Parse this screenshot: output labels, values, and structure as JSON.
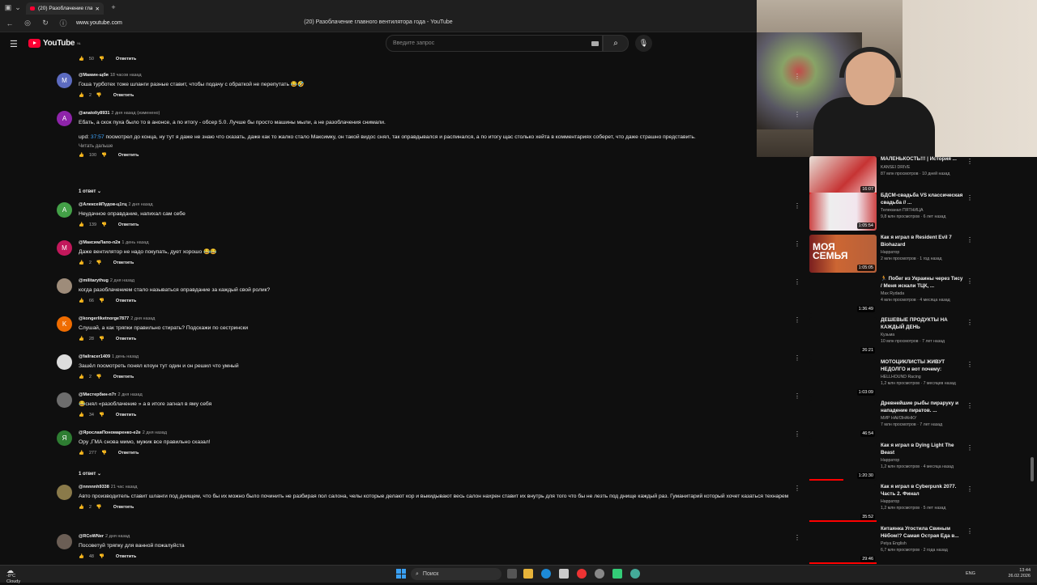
{
  "browser": {
    "tab_title": "(20) Разоблачение гла",
    "url": "www.youtube.com",
    "page_title": "(20) Разоблачение главного вентилятора года - YouTube"
  },
  "youtube": {
    "logo_text": "YouTube",
    "region": "NL",
    "search_placeholder": "Введите запрос"
  },
  "comments": {
    "top_actions": {
      "likes": "50",
      "reply": "Ответить"
    },
    "items": [
      {
        "author": "@Мамин-щбя",
        "time": "18 часов назад",
        "text": "Гоша турботех тоже шланги разные ставит, чтобы подачу с обраткой не перепутать 😂🤣",
        "likes": "2",
        "reply": "Ответить",
        "avatar": "M",
        "color": "#5c6bc0"
      },
      {
        "author": "@anatoliy8931",
        "time": "2 дня назад (изменено)",
        "text": "Ебать, а скок пуха было то в анонсе, а по итогу - обсер 5.0. Лучше бы просто машины мыли, а не разоблачения снимали.",
        "ts": "37:57",
        "text2": " посмотрел до конца, ну тут я даже не знаю что сказать, даже как то жалко стало Максимку, он такой видос снял, так оправдывался и распинался, а по итогу щас столько хейта в комментариях соберет, что даже страшно представить.",
        "upd": "upd: ",
        "more": "Читать дальше",
        "likes": "100",
        "reply": "Ответить",
        "avatar": "A",
        "color": "#8e24aa",
        "replies": "1 ответ"
      },
      {
        "author": "@АлексейПудов-ц1тц",
        "time": "2 дня назад",
        "text": "Неудачное оправдание, напихал сам себе",
        "likes": "139",
        "reply": "Ответить",
        "avatar": "A",
        "color": "#43a047"
      },
      {
        "author": "@МаксимЛапо-п2я",
        "time": "1 день назад",
        "text": "Даже вентилятор не надо покупать, дует хорошо 😂😂",
        "likes": "2",
        "reply": "Ответить",
        "avatar": "M",
        "color": "#c2185b"
      },
      {
        "author": "@militarythug",
        "time": "2 дня назад",
        "text": "когда разоблачением стало называться оправдание за каждый свой ролик?",
        "likes": "66",
        "reply": "Ответить",
        "avatar": "",
        "color": "#9e8c7a"
      },
      {
        "author": "@kongerliketnorge7877",
        "time": "2 дня назад",
        "text": "Слушай, а как тряпки правильно стирать? Подскажи по сестрински",
        "likes": "28",
        "reply": "Ответить",
        "avatar": "K",
        "color": "#ef6c00"
      },
      {
        "author": "@failracer1409",
        "time": "1 день назад",
        "text": "Зашёл посмотреть понял клоун тут один и он решил что умный",
        "likes": "2",
        "reply": "Ответить",
        "avatar": "",
        "color": "#ddd"
      },
      {
        "author": "@Мистербин-п7т",
        "time": "2 дня назад",
        "text": "😂снял «разоблачение » а в итоге загнал в яму себя",
        "likes": "34",
        "reply": "Ответить",
        "avatar": "",
        "color": "#6d6d6d"
      },
      {
        "author": "@ЯрославПономаренко-е2е",
        "time": "2 дня назад",
        "text": "Ору ,ГМА  снова мимо, мужик все правильно сказал!",
        "likes": "277",
        "reply": "Ответить",
        "avatar": "Я",
        "color": "#2e7d32",
        "replies": "1 ответ"
      },
      {
        "author": "@nnnnnh9338",
        "time": "21 час назад",
        "text": "Авто производитель ставит шланги под днищем, что бы их можно было починить не разбирая пол салона, челы которые делают кор и выкидывают весь салон нахрен ставит их внутрь для того что бы не лезть под днище каждый раз. Гуманитарий который хочет казаться технарем",
        "likes": "2",
        "reply": "Ответить",
        "avatar": "",
        "color": "#8a7a4a"
      },
      {
        "author": "@RCoWNer",
        "time": "2 дня назад",
        "text": "Посоветуй тряпку для ванной пожалуйста",
        "likes": "48",
        "reply": "Ответить",
        "avatar": "",
        "color": "#6b5e55"
      }
    ]
  },
  "sidebar": {
    "videos": [
      {
        "title": "МАЛЕНЬКОСТЬ!!! | История ...",
        "channel": "KANSEI DRIVE",
        "meta": "87 млн просмотров · 10 дней назад",
        "duration": "16:07",
        "progress": 1.0
      },
      {
        "title": "БДСМ-свадьба VS классическая свадьба // ...",
        "channel": "Телеканал ПЯТНИЦА",
        "meta": "9,8 млн просмотров · 6 лет назад",
        "duration": "1:05:54"
      },
      {
        "title": "Как я играл в Resident Evil 7 Biohazard",
        "channel": "Нарратор",
        "meta": "2 млн просмотров · 1 год назад",
        "duration": "1:05:05",
        "thumb_text": "МОЯ СЕМЬЯ"
      },
      {
        "title": "🏃 Побег из Украины через Тису / Меня искали ТЦК, ...",
        "channel": "Max Rydada",
        "meta": "4 млн просмотров · 4 месяца назад",
        "duration": "1:36:49"
      },
      {
        "title": "ДЕШЕВЫЕ ПРОДУКТЫ НА КАЖДЫЙ ДЕНЬ",
        "channel": "Кузьма",
        "meta": "10 млн просмотров · 7 лет назад",
        "duration": "26:21"
      },
      {
        "title": "МОТОЦИКЛИСТЫ ЖИВУТ НЕДОЛГО и вот почему:",
        "channel": "HELLHOUND Racing",
        "meta": "1,2 млн просмотров · 7 месяцев назад",
        "duration": "1:03:09"
      },
      {
        "title": "Древнейшие рыбы пираруку и нападение пиратов. ...",
        "channel": "МИР НАИЗНАНКУ",
        "meta": "7 млн просмотров · 7 лет назад",
        "duration": "46:54"
      },
      {
        "title": "Как я играл в Dying Light The Beast",
        "channel": "Нарратор",
        "meta": "1,2 млн просмотров · 4 месяца назад",
        "duration": "1:20:30",
        "progress": 0.5
      },
      {
        "title": "Как я играл в Cyberpunk 2077. Часть 2. Финал",
        "channel": "Нарратор",
        "meta": "1,2 млн просмотров · 5 лет назад",
        "duration": "35:52",
        "progress": 1.0
      },
      {
        "title": "Китаянка Угостила Свиным Нёбом!? Самая Острая Еда в...",
        "channel": "Petya English",
        "meta": "6,7 млн просмотров · 2 года назад",
        "duration": "29:46",
        "progress": 1.0
      }
    ]
  },
  "taskbar": {
    "temp": "-8°C",
    "weather": "Cloudy",
    "search": "Поиск",
    "lang": "ENG",
    "time": "13:44",
    "date": "26.02.2026"
  }
}
